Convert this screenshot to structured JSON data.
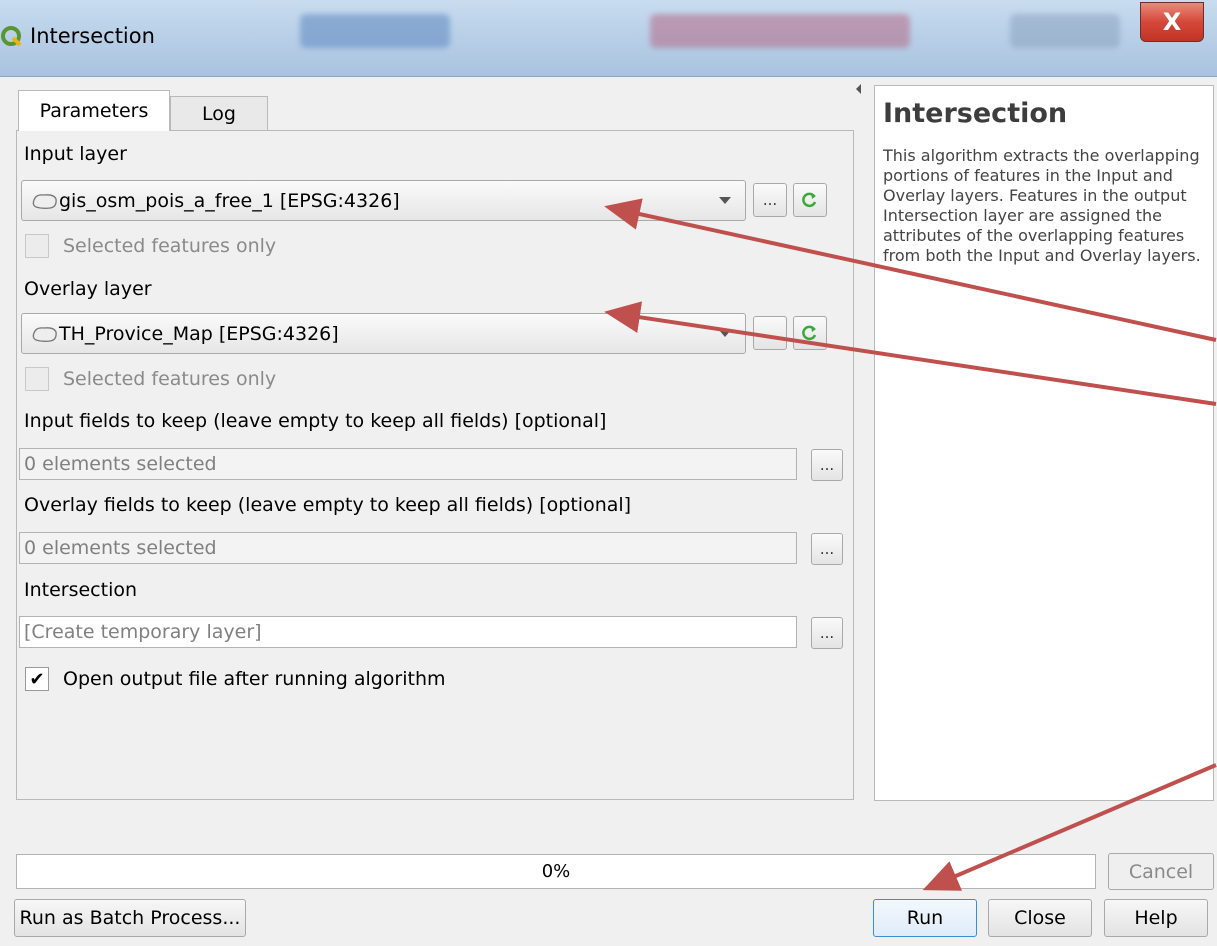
{
  "window": {
    "title": "Intersection",
    "close_glyph": "X"
  },
  "tabs": [
    {
      "label": "Parameters",
      "active": true
    },
    {
      "label": "Log",
      "active": false
    }
  ],
  "params": {
    "input_layer_label": "Input layer",
    "input_layer_value": "gis_osm_pois_a_free_1 [EPSG:4326]",
    "selected_only_label": "Selected features only",
    "overlay_layer_label": "Overlay layer",
    "overlay_layer_value": "TH_Provice_Map [EPSG:4326]",
    "input_fields_label": "Input fields to keep (leave empty to keep all fields) [optional]",
    "input_fields_value": "0 elements selected",
    "overlay_fields_label": "Overlay fields to keep (leave empty to keep all fields) [optional]",
    "overlay_fields_value": "0 elements selected",
    "output_label": "Intersection",
    "output_placeholder": "[Create temporary layer]",
    "open_output_label": "Open output file after running algorithm",
    "ellipsis": "...",
    "checkmark": "✔"
  },
  "help": {
    "title": "Intersection",
    "text": "This algorithm extracts the overlapping portions of features in the Input and Overlay layers. Features in the output Intersection layer are assigned the attributes of the overlapping features from both the Input and Overlay layers."
  },
  "progress": {
    "value": 0,
    "text": "0%"
  },
  "buttons": {
    "cancel": "Cancel",
    "batch": "Run as Batch Process...",
    "run": "Run",
    "close": "Close",
    "help": "Help"
  },
  "colors": {
    "annotation_arrow": "#c0504d",
    "titlebar": "#b9d0e8",
    "refresh_icon": "#3aa83a"
  },
  "icons": [
    "qgis-logo-icon",
    "polygon-layer-icon",
    "refresh-icon",
    "dropdown-arrow-icon",
    "collapse-arrow-icon"
  ]
}
